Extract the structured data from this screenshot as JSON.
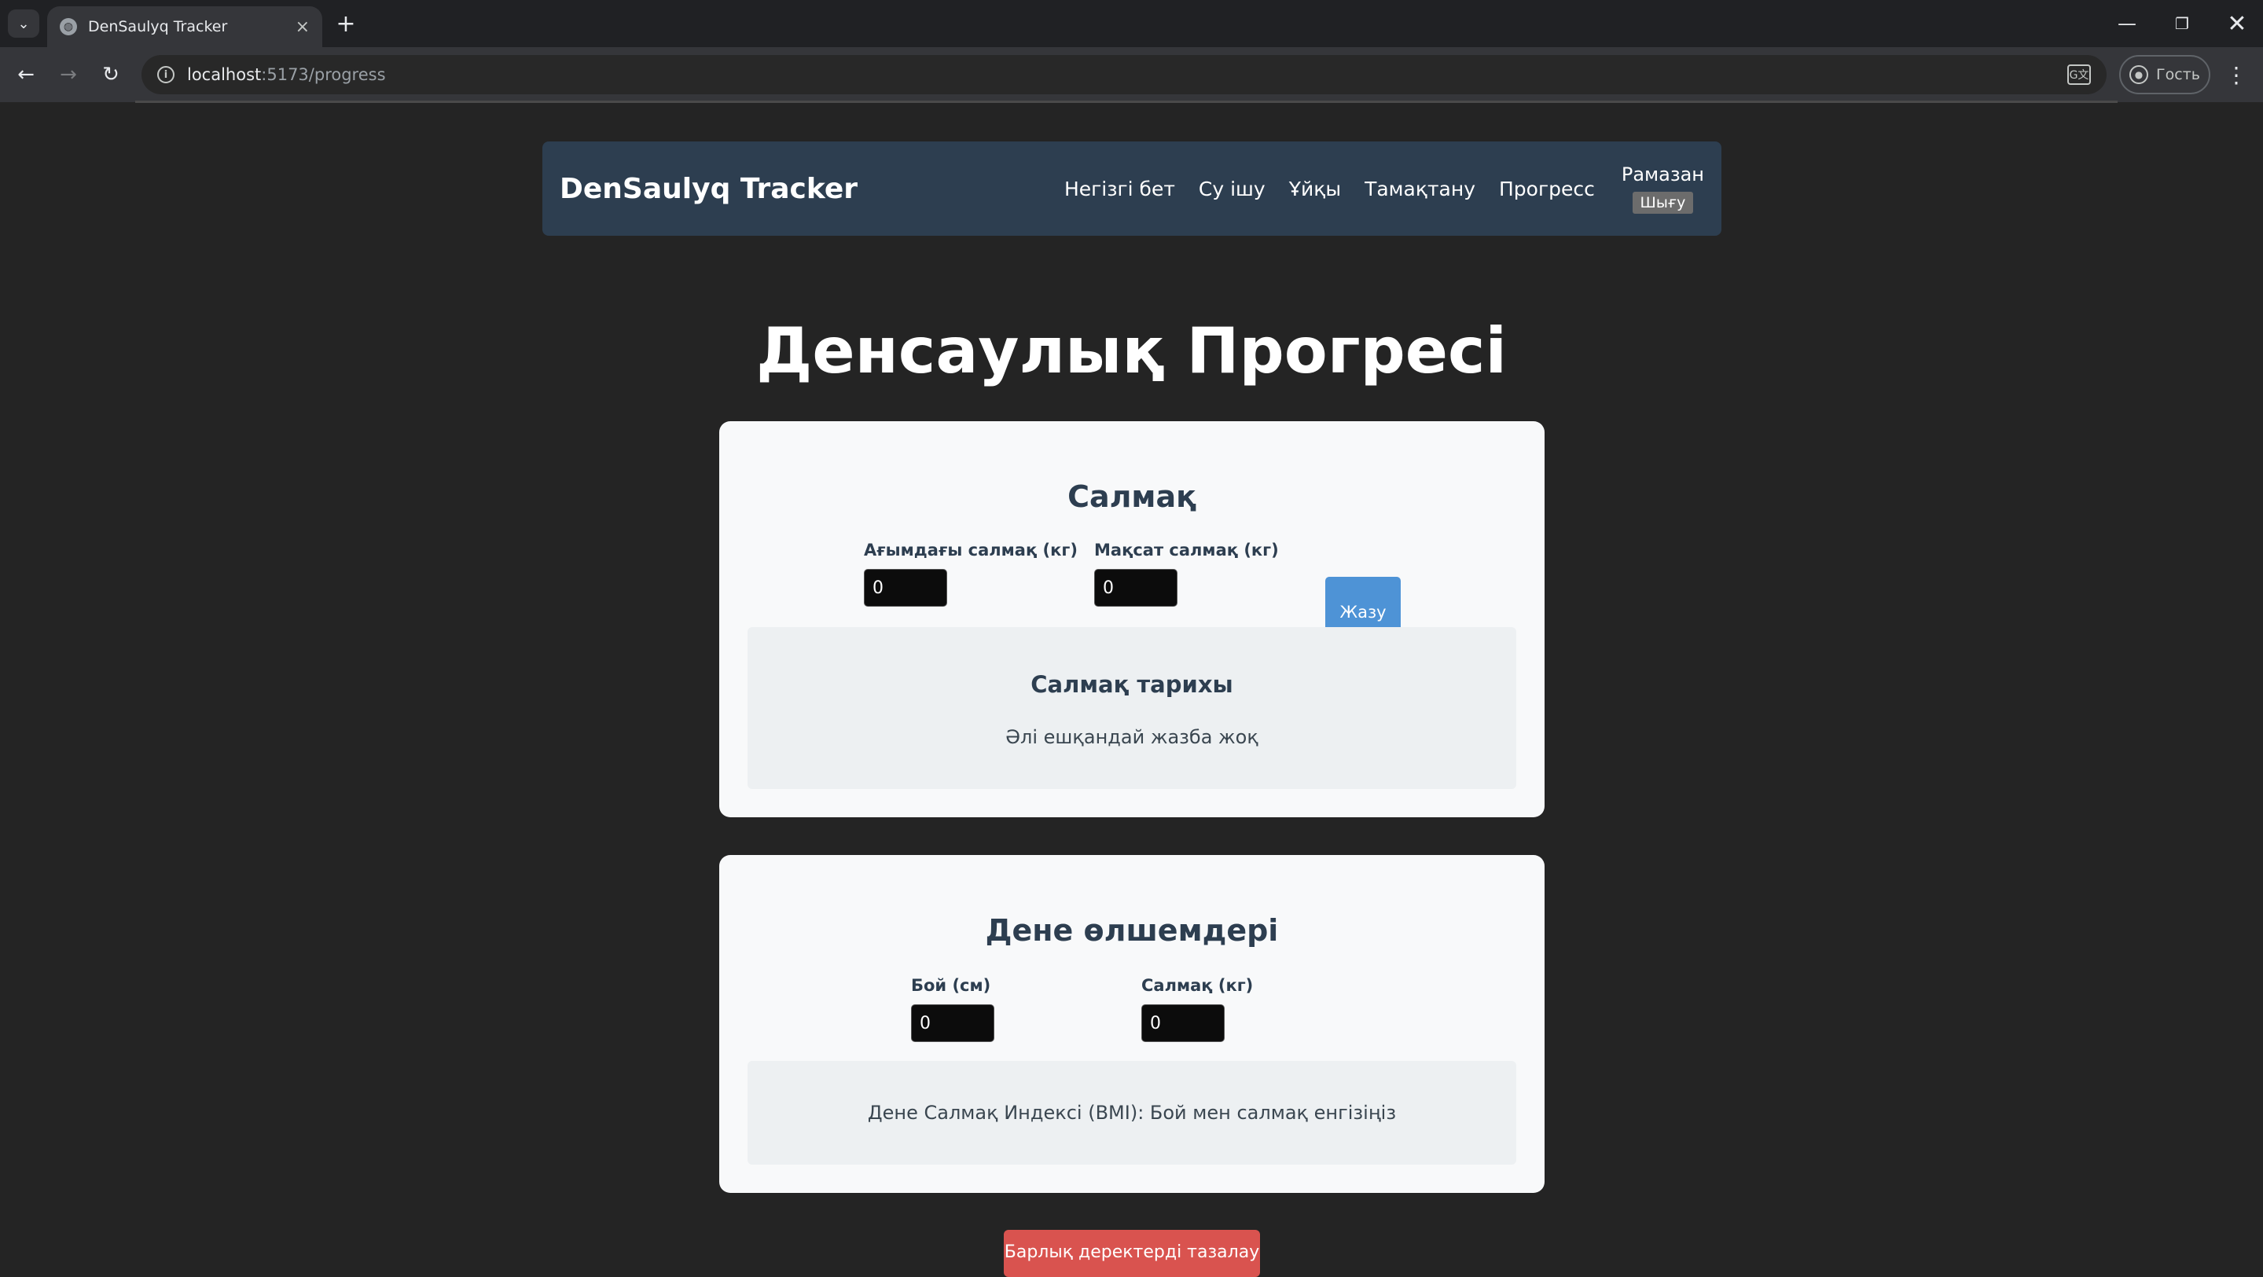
{
  "browser": {
    "tab_title": "DenSaulyq Tracker",
    "url_host": "localhost",
    "url_path": ":5173/progress",
    "profile_label": "Гость"
  },
  "navbar": {
    "brand": "DenSaulyq Tracker",
    "links": [
      "Негізгі бет",
      "Су ішу",
      "Ұйқы",
      "Тамақтану",
      "Прогресс"
    ],
    "user_name": "Рамазан",
    "logout_label": "Шығу"
  },
  "page": {
    "title": "Денсаулық Прогресі"
  },
  "weight": {
    "title": "Салмақ",
    "current_label": "Ағымдағы салмақ (кг)",
    "current_value": "0",
    "target_label": "Мақсат салмақ (кг)",
    "target_value": "0",
    "save_label": "Жазу",
    "history_title": "Салмақ тарихы",
    "history_empty": "Әлі ешқандай жазба жоқ"
  },
  "body": {
    "title": "Дене өлшемдері",
    "height_label": "Бой (см)",
    "height_value": "0",
    "weight_label": "Салмақ (кг)",
    "weight_value": "0",
    "bmi_text": "Дене Салмақ Индексі (BMI): Бой мен салмақ енгізіңіз"
  },
  "footer_button": {
    "label": "Барлық деректерді тазалау"
  }
}
